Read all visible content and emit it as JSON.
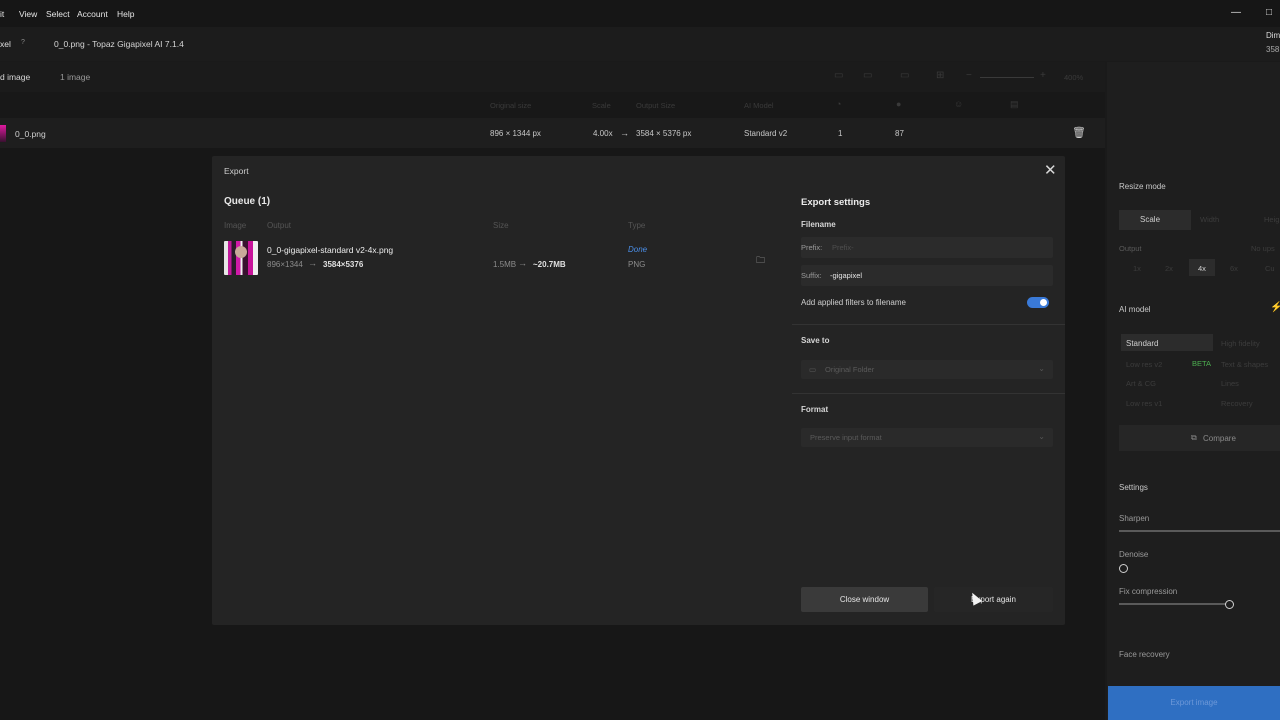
{
  "menu": {
    "items": [
      "it",
      "View",
      "Select",
      "Account",
      "Help"
    ],
    "minimize": "—",
    "maximize": "□"
  },
  "titlebar": {
    "app_fragment": "xel",
    "help_badge": "?",
    "title": "0_0.png - Topaz Gigapixel AI 7.1.4",
    "right_label_1": "Dim",
    "right_label_2": "358"
  },
  "toolbar": {
    "tab_left": "d image",
    "tab_count": "1 image",
    "zoom": "400%"
  },
  "table": {
    "headers": [
      "Original size",
      "Scale",
      "Output Size",
      "AI Model"
    ],
    "row": {
      "filename": "0_0.png",
      "original_size": "896 × 1344 px",
      "scale": "4.00x",
      "output_size": "3584 × 5376 px",
      "model": "Standard v2",
      "col_a": "1",
      "col_b": "87"
    }
  },
  "right_panel": {
    "resize_mode_label": "Resize mode",
    "scale_tab": "Scale",
    "width_tab": "Width",
    "height_tab": "Heig",
    "output_label": "Output",
    "output_right": "No ups",
    "scale_options": [
      "1x",
      "2x",
      "4x",
      "6x",
      "Cu"
    ],
    "ai_model_label": "AI model",
    "model_standard": "Standard",
    "model_high_fidelity": "High fidelity",
    "model_low_res_v2": "Low res v2",
    "beta_badge": "BETA",
    "model_text_shapes": "Text & shapes",
    "model_art_cg": "Art & CG",
    "model_lines": "Lines",
    "model_low_res_v1": "Low res v1",
    "model_recovery": "Recovery",
    "compare_label": "Compare",
    "settings_label": "Settings",
    "sharpen_label": "Sharpen",
    "denoise_label": "Denoise",
    "fix_compression_label": "Fix compression",
    "face_recovery_label": "Face recovery",
    "export_image_label": "Export image",
    "colors": {
      "beta": "#4caf50",
      "accent": "#2f6fc2"
    }
  },
  "dialog": {
    "title": "Export",
    "queue_title": "Queue (1)",
    "columns": [
      "Image",
      "Output",
      "Size",
      "Type"
    ],
    "item": {
      "filename": "0_0-gigapixel-standard v2-4x.png",
      "dims_from": "896×1344",
      "dims_to": "3584×5376",
      "size_from": "1.5MB",
      "size_to": "~20.7MB",
      "status": "Done",
      "type": "PNG"
    },
    "settings": {
      "title": "Export settings",
      "filename_label": "Filename",
      "prefix_label": "Prefix:",
      "prefix_placeholder": "Prefix-",
      "suffix_label": "Suffix:",
      "suffix_value": "-gigapixel",
      "add_filters_label": "Add applied filters to filename",
      "add_filters_enabled": true,
      "save_to_label": "Save to",
      "save_to_value": "Original Folder",
      "format_label": "Format",
      "format_value": "Preserve input format"
    },
    "buttons": {
      "close_window": "Close window",
      "export_again": "Export again"
    }
  }
}
